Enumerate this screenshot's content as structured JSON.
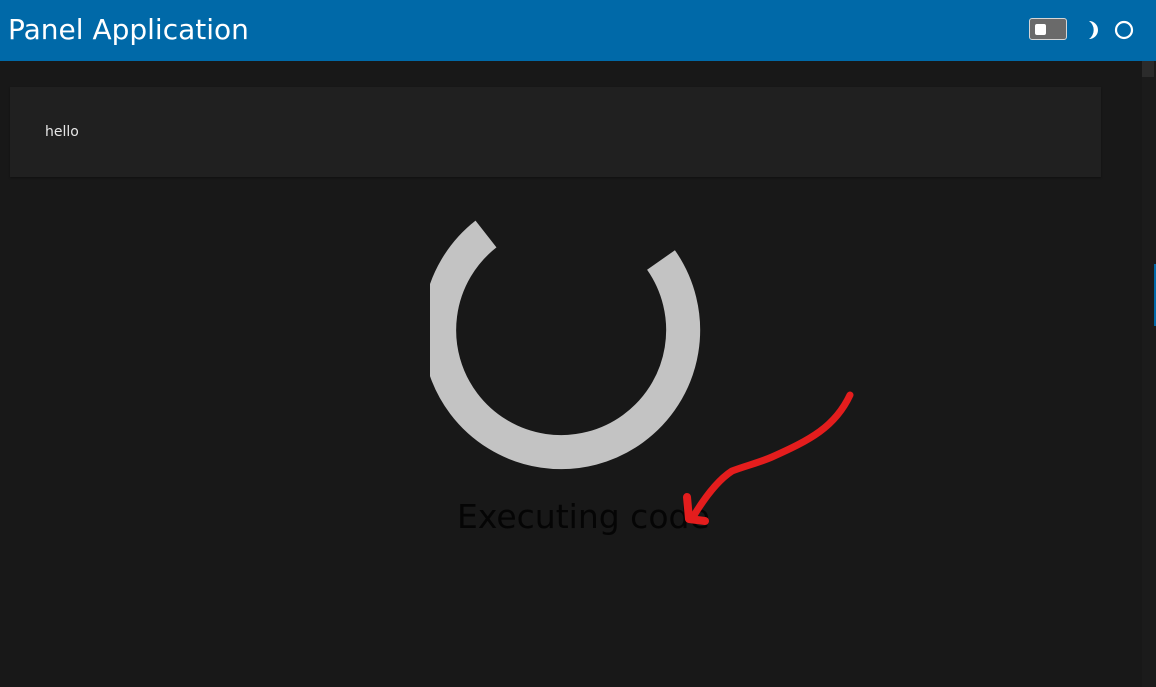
{
  "header": {
    "title": "Panel Application",
    "theme_toggle_icon": "toggle-switch-icon",
    "moon_icon": "moon-icon",
    "busy_icon": "circle-icon"
  },
  "main": {
    "card_text": "hello",
    "loading_text": "Executing code"
  },
  "colors": {
    "header": "#0069a8",
    "background": "#181818",
    "card": "#202020",
    "spinner": "#c3c3c3",
    "annotation": "#e41d1d"
  }
}
